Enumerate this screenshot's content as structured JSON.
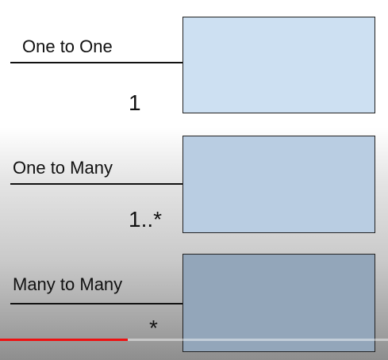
{
  "rows": [
    {
      "label": "One to One",
      "multiplicity": "1",
      "box_color": "#cde0f2"
    },
    {
      "label": "One to Many",
      "multiplicity": "1..*",
      "box_color": "#b9cde2"
    },
    {
      "label": "Many to Many",
      "multiplicity": "*",
      "box_color": "#93a6ba"
    }
  ],
  "video": {
    "progress_fraction": 0.33,
    "progress_color": "#ee1111"
  }
}
